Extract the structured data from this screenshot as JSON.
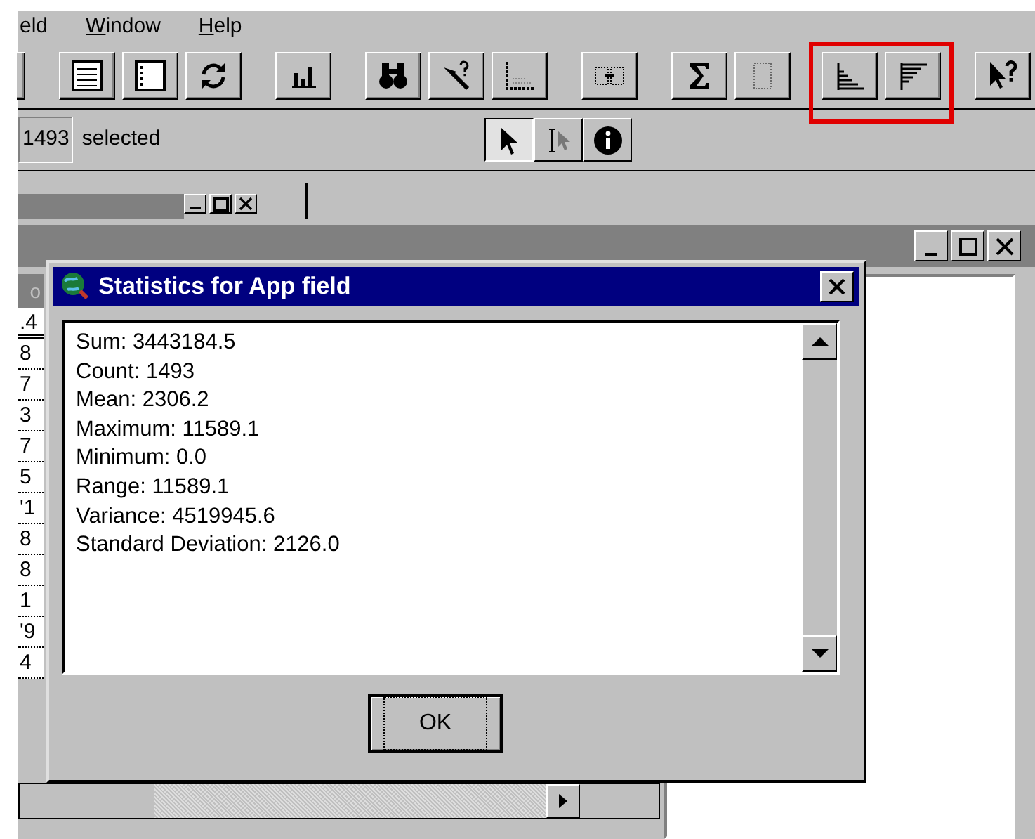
{
  "menu": [
    {
      "label": "eld",
      "mnemonic": false
    },
    {
      "label": "Window",
      "mnemonic": true
    },
    {
      "label": "Help",
      "mnemonic": true
    }
  ],
  "toolbar": [
    {
      "highlighted": false,
      "buttons": [
        {
          "kind": "edge"
        }
      ]
    },
    {
      "highlighted": false,
      "buttons": [
        {
          "kind": "list",
          "disabled": false
        },
        {
          "kind": "window",
          "disabled": false
        },
        {
          "kind": "refresh",
          "disabled": false
        }
      ]
    },
    {
      "highlighted": false,
      "buttons": [
        {
          "kind": "chart",
          "disabled": false
        }
      ]
    },
    {
      "highlighted": false,
      "buttons": [
        {
          "kind": "find",
          "disabled": false
        },
        {
          "kind": "query",
          "disabled": false
        },
        {
          "kind": "graph",
          "disabled": false
        }
      ]
    },
    {
      "highlighted": false,
      "buttons": [
        {
          "kind": "link",
          "disabled": false
        }
      ]
    },
    {
      "highlighted": false,
      "buttons": [
        {
          "kind": "sum",
          "disabled": false
        },
        {
          "kind": "grid",
          "disabled": true
        }
      ]
    },
    {
      "highlighted": true,
      "buttons": [
        {
          "kind": "ascending",
          "disabled": false
        },
        {
          "kind": "descending",
          "disabled": false
        }
      ]
    },
    {
      "highlighted": false,
      "buttons": [
        {
          "kind": "help",
          "disabled": false
        }
      ]
    }
  ],
  "selection": {
    "count": "1493",
    "label": "selected"
  },
  "tools": [
    {
      "kind": "pointer",
      "selected": true
    },
    {
      "kind": "select",
      "selected": false
    },
    {
      "kind": "info",
      "selected": false
    }
  ],
  "table": {
    "header": "o",
    "subheader": ".4",
    "rows": [
      "8",
      "7",
      "3",
      "7",
      "5",
      "'1",
      "8",
      "8",
      "1",
      "'9",
      "4"
    ]
  },
  "dialog": {
    "title": "Statistics for App field",
    "lines": [
      "Sum: 3443184.5",
      "Count: 1493",
      "Mean: 2306.2",
      "Maximum: 11589.1",
      "Minimum: 0.0",
      "Range: 11589.1",
      "Variance: 4519945.6",
      "Standard Deviation: 2126.0"
    ],
    "button": "OK"
  }
}
